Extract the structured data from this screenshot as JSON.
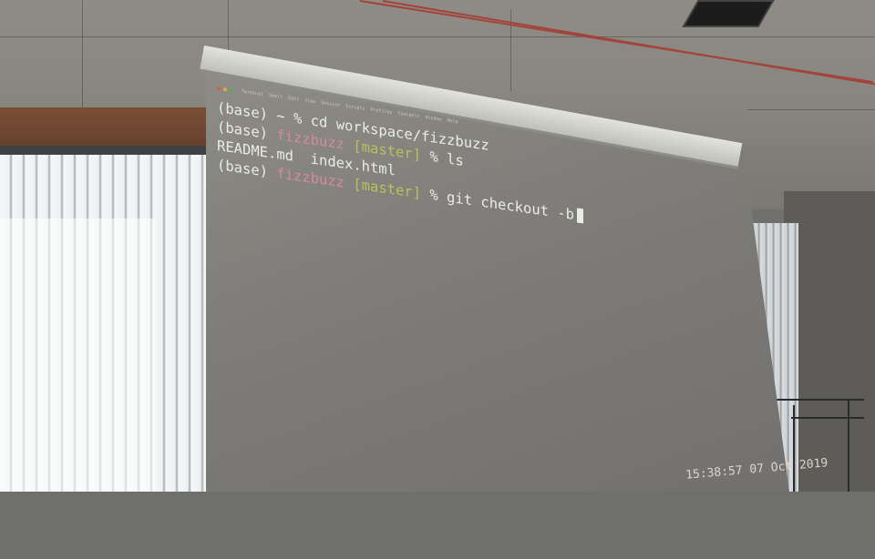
{
  "terminal": {
    "menubar_items": [
      "Terminal",
      "Shell",
      "Edit",
      "View",
      "Session",
      "Scripts",
      "Profiles",
      "Toolbelt",
      "Window",
      "Help"
    ],
    "line1": {
      "env": "(base)",
      "dir": "~",
      "prompt": "%",
      "command": "cd workspace/fizzbuzz"
    },
    "line2": {
      "env": "(base)",
      "dir": "fizzbuzz",
      "branch": "[master]",
      "prompt": "%",
      "command": "ls"
    },
    "line3": {
      "output": "README.md  index.html"
    },
    "line4": {
      "env": "(base)",
      "dir": "fizzbuzz",
      "branch": "[master]",
      "prompt": "%",
      "command": "git checkout -b"
    }
  },
  "clock": "15:38:57 07 Oct 2019",
  "colors": {
    "terminal_bg": "#7e7c78",
    "text": "#ecece6",
    "dir": "#d38ba0",
    "branch": "#b7c35a"
  }
}
